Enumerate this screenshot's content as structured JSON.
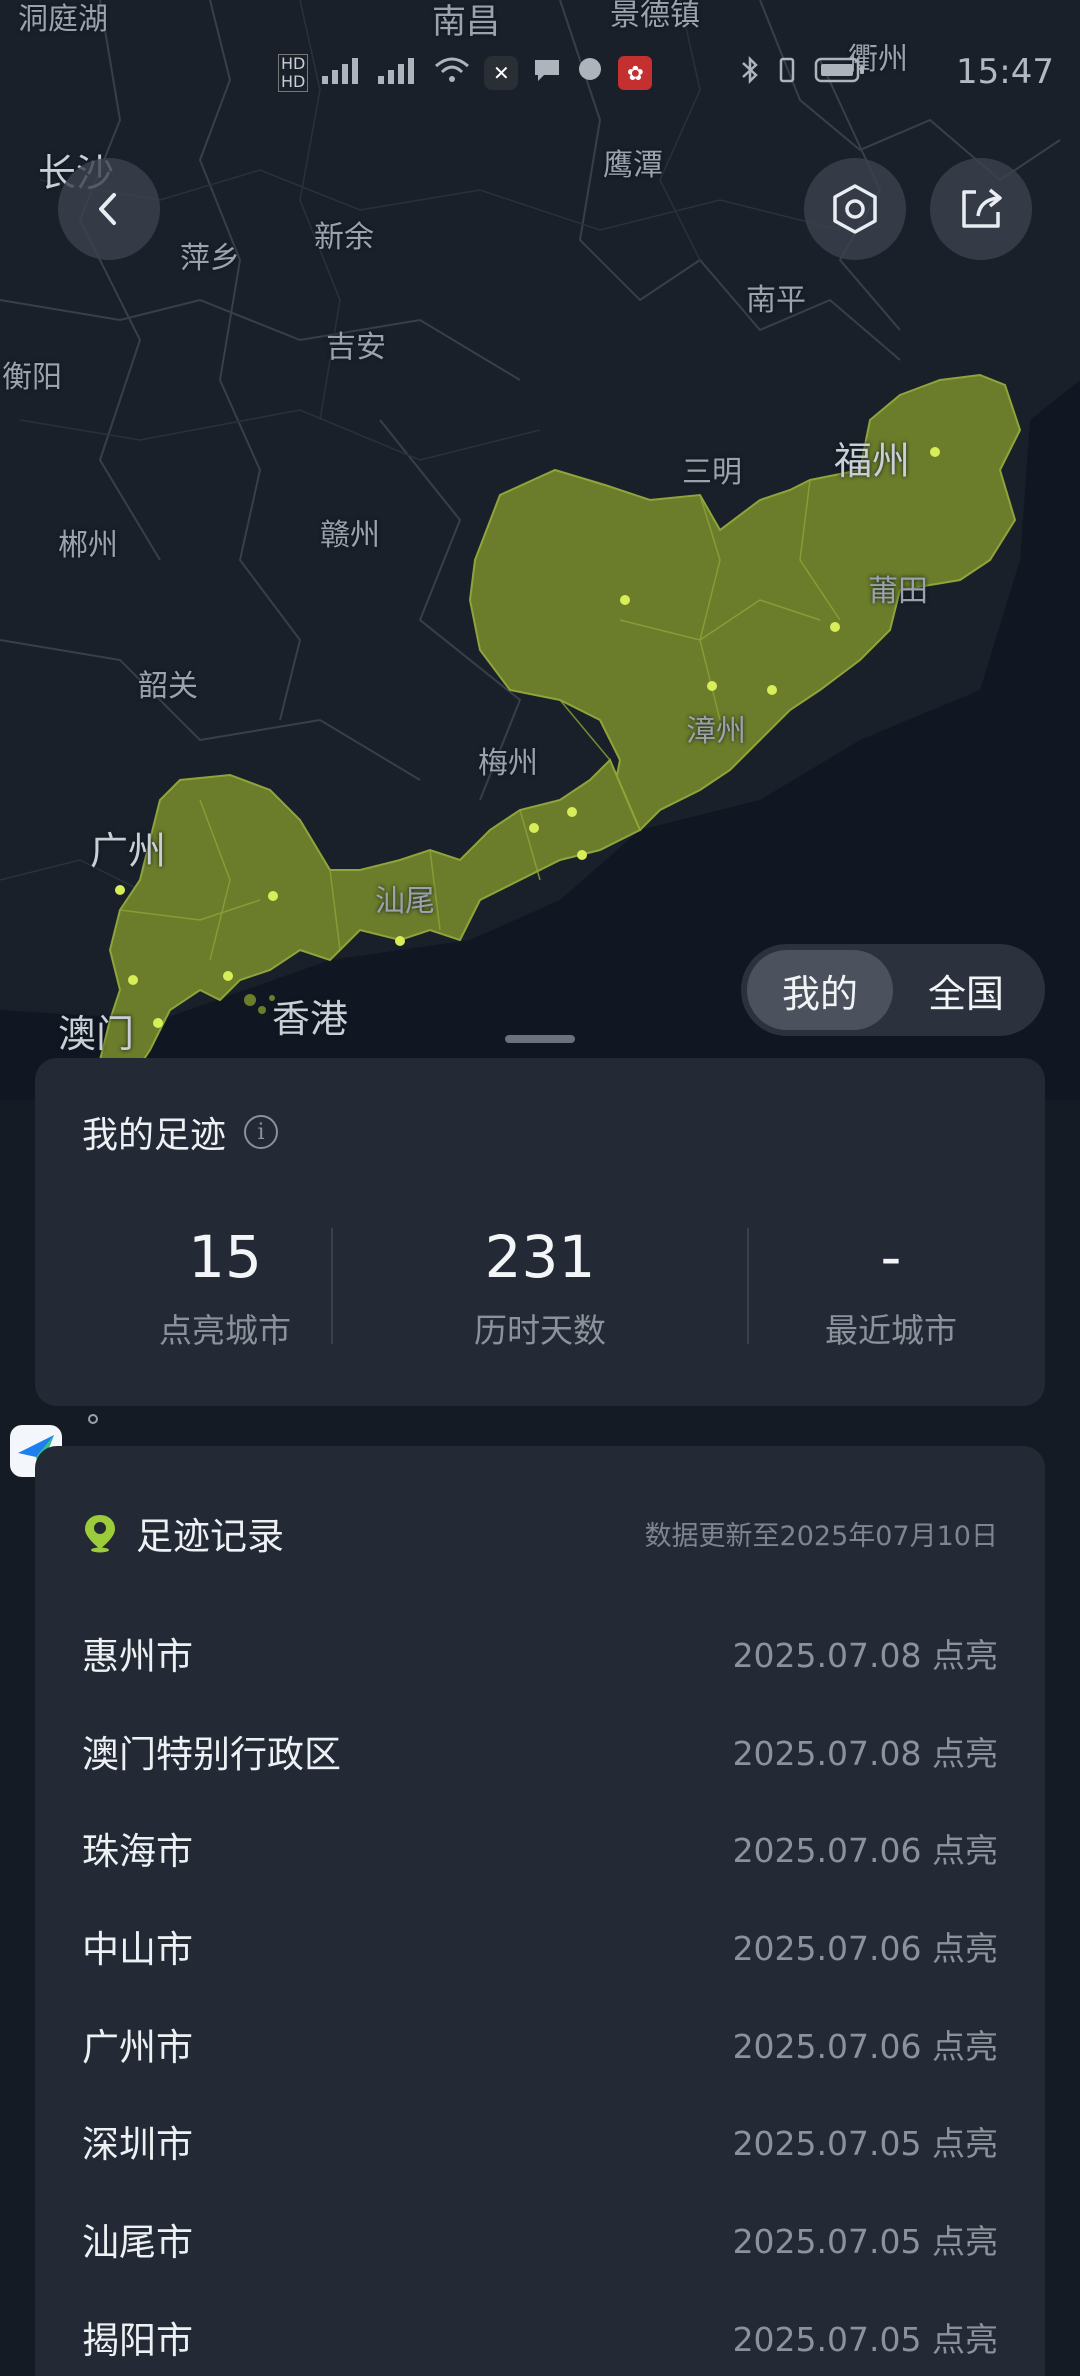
{
  "status_bar": {
    "time": "15:47"
  },
  "map": {
    "labels": [
      "南昌",
      "景德镇",
      "衢州",
      "长沙",
      "鹰潭",
      "萍乡",
      "新余",
      "南平",
      "吉安",
      "衡阳",
      "三明",
      "福州",
      "郴州",
      "赣州",
      "莆田",
      "韶关",
      "漳州",
      "梅州",
      "广州",
      "汕尾",
      "澳门",
      "香港",
      "洞庭湖"
    ],
    "highlight_color": "#6b7d2a",
    "city_dot_color": "#d7ee5a"
  },
  "toggle": {
    "mine": "我的",
    "national": "全国",
    "selected": "我的"
  },
  "stats": {
    "title": "我的足迹",
    "cities_value": "15",
    "cities_label": "点亮城市",
    "days_value": "231",
    "days_label": "历时天数",
    "recent_value": "-",
    "recent_label": "最近城市"
  },
  "records": {
    "title": "足迹记录",
    "update_note": "数据更新至2025年07月10日",
    "items": [
      {
        "city": "惠州市",
        "date": "2025.07.08 点亮"
      },
      {
        "city": "澳门特别行政区",
        "date": "2025.07.08 点亮"
      },
      {
        "city": "珠海市",
        "date": "2025.07.06 点亮"
      },
      {
        "city": "中山市",
        "date": "2025.07.06 点亮"
      },
      {
        "city": "广州市",
        "date": "2025.07.06 点亮"
      },
      {
        "city": "深圳市",
        "date": "2025.07.05 点亮"
      },
      {
        "city": "汕尾市",
        "date": "2025.07.05 点亮"
      },
      {
        "city": "揭阳市",
        "date": "2025.07.05 点亮"
      }
    ]
  }
}
